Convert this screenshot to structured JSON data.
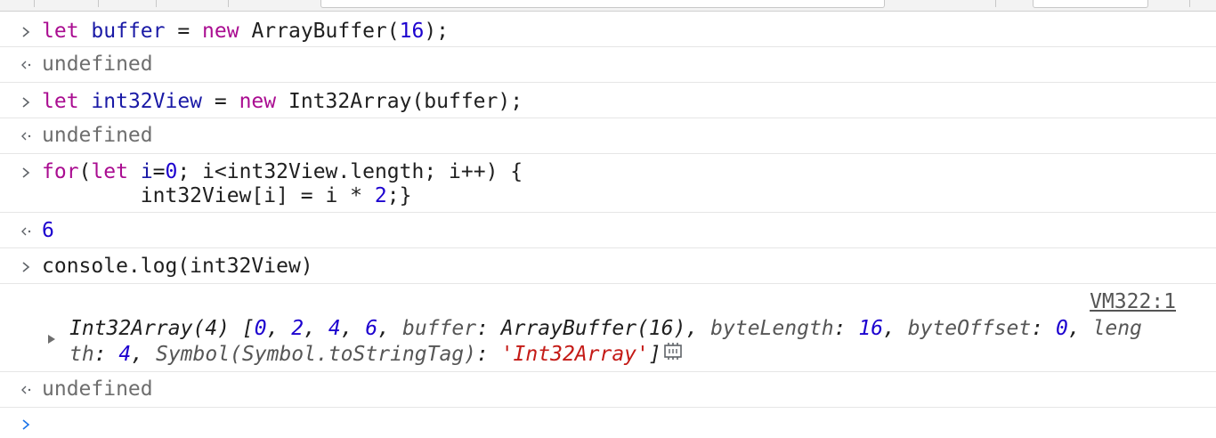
{
  "entries": [
    {
      "input_tokens": [
        {
          "t": "let",
          "c": "kw"
        },
        {
          "t": " ",
          "c": "plain"
        },
        {
          "t": "buffer",
          "c": "id-var"
        },
        {
          "t": " = ",
          "c": "plain"
        },
        {
          "t": "new",
          "c": "kw"
        },
        {
          "t": " ArrayBuffer(",
          "c": "plain"
        },
        {
          "t": "16",
          "c": "num"
        },
        {
          "t": ");",
          "c": "plain"
        }
      ],
      "result": "undefined"
    },
    {
      "input_tokens": [
        {
          "t": "let",
          "c": "kw"
        },
        {
          "t": " ",
          "c": "plain"
        },
        {
          "t": "int32View",
          "c": "id-var"
        },
        {
          "t": " = ",
          "c": "plain"
        },
        {
          "t": "new",
          "c": "kw"
        },
        {
          "t": " Int32Array(buffer);",
          "c": "plain"
        }
      ],
      "result": "undefined"
    },
    {
      "input_line1_tokens": [
        {
          "t": "for",
          "c": "kw"
        },
        {
          "t": "(",
          "c": "plain"
        },
        {
          "t": "let",
          "c": "kw"
        },
        {
          "t": " ",
          "c": "plain"
        },
        {
          "t": "i",
          "c": "id-var"
        },
        {
          "t": "=",
          "c": "plain"
        },
        {
          "t": "0",
          "c": "num"
        },
        {
          "t": "; i<int32View.length; i++) {",
          "c": "plain"
        }
      ],
      "input_line2_tokens": [
        {
          "t": "        int32View[i] = i * ",
          "c": "plain"
        },
        {
          "t": "2",
          "c": "num"
        },
        {
          "t": ";}",
          "c": "plain"
        }
      ],
      "result": "6"
    },
    {
      "input": "console.log(int32View)",
      "source_link": "VM322:1",
      "log_line1_tokens": [
        {
          "t": "Int32Array(4) [",
          "c": "oname"
        },
        {
          "t": "0",
          "c": "onum"
        },
        {
          "t": ", ",
          "c": "oname"
        },
        {
          "t": "2",
          "c": "onum"
        },
        {
          "t": ", ",
          "c": "oname"
        },
        {
          "t": "4",
          "c": "onum"
        },
        {
          "t": ", ",
          "c": "oname"
        },
        {
          "t": "6",
          "c": "onum"
        },
        {
          "t": ", ",
          "c": "oname"
        },
        {
          "t": "buffer",
          "c": "okey"
        },
        {
          "t": ": ArrayBuffer(16), ",
          "c": "oname"
        },
        {
          "t": "byteLength",
          "c": "okey"
        },
        {
          "t": ": ",
          "c": "oname"
        },
        {
          "t": "16",
          "c": "onum"
        },
        {
          "t": ", ",
          "c": "oname"
        },
        {
          "t": "byteOffset",
          "c": "okey"
        },
        {
          "t": ": ",
          "c": "oname"
        },
        {
          "t": "0",
          "c": "onum"
        },
        {
          "t": ", ",
          "c": "oname"
        },
        {
          "t": "leng",
          "c": "okey"
        }
      ],
      "log_line2_tokens": [
        {
          "t": "th",
          "c": "okey"
        },
        {
          "t": ": ",
          "c": "oname"
        },
        {
          "t": "4",
          "c": "onum"
        },
        {
          "t": ", ",
          "c": "oname"
        },
        {
          "t": "Symbol(Symbol.toStringTag)",
          "c": "okey"
        },
        {
          "t": ": ",
          "c": "oname"
        },
        {
          "t": "'Int32Array'",
          "c": "ostr"
        },
        {
          "t": "]",
          "c": "oname"
        }
      ],
      "result": "undefined"
    }
  ],
  "icons": {
    "input_prompt": "chevron-right-icon",
    "result_marker": "result-arrow-left-icon",
    "expand": "expand-triangle-icon",
    "memory": "memory-inspector-icon",
    "prompt_active": "prompt-chevron-icon"
  },
  "colors": {
    "keyword": "#aa0d91",
    "number": "#1c00cf",
    "variable": "#1a1aa6",
    "string": "#c41a16",
    "muted": "#6e6e6e",
    "prompt": "#1a73e8"
  }
}
